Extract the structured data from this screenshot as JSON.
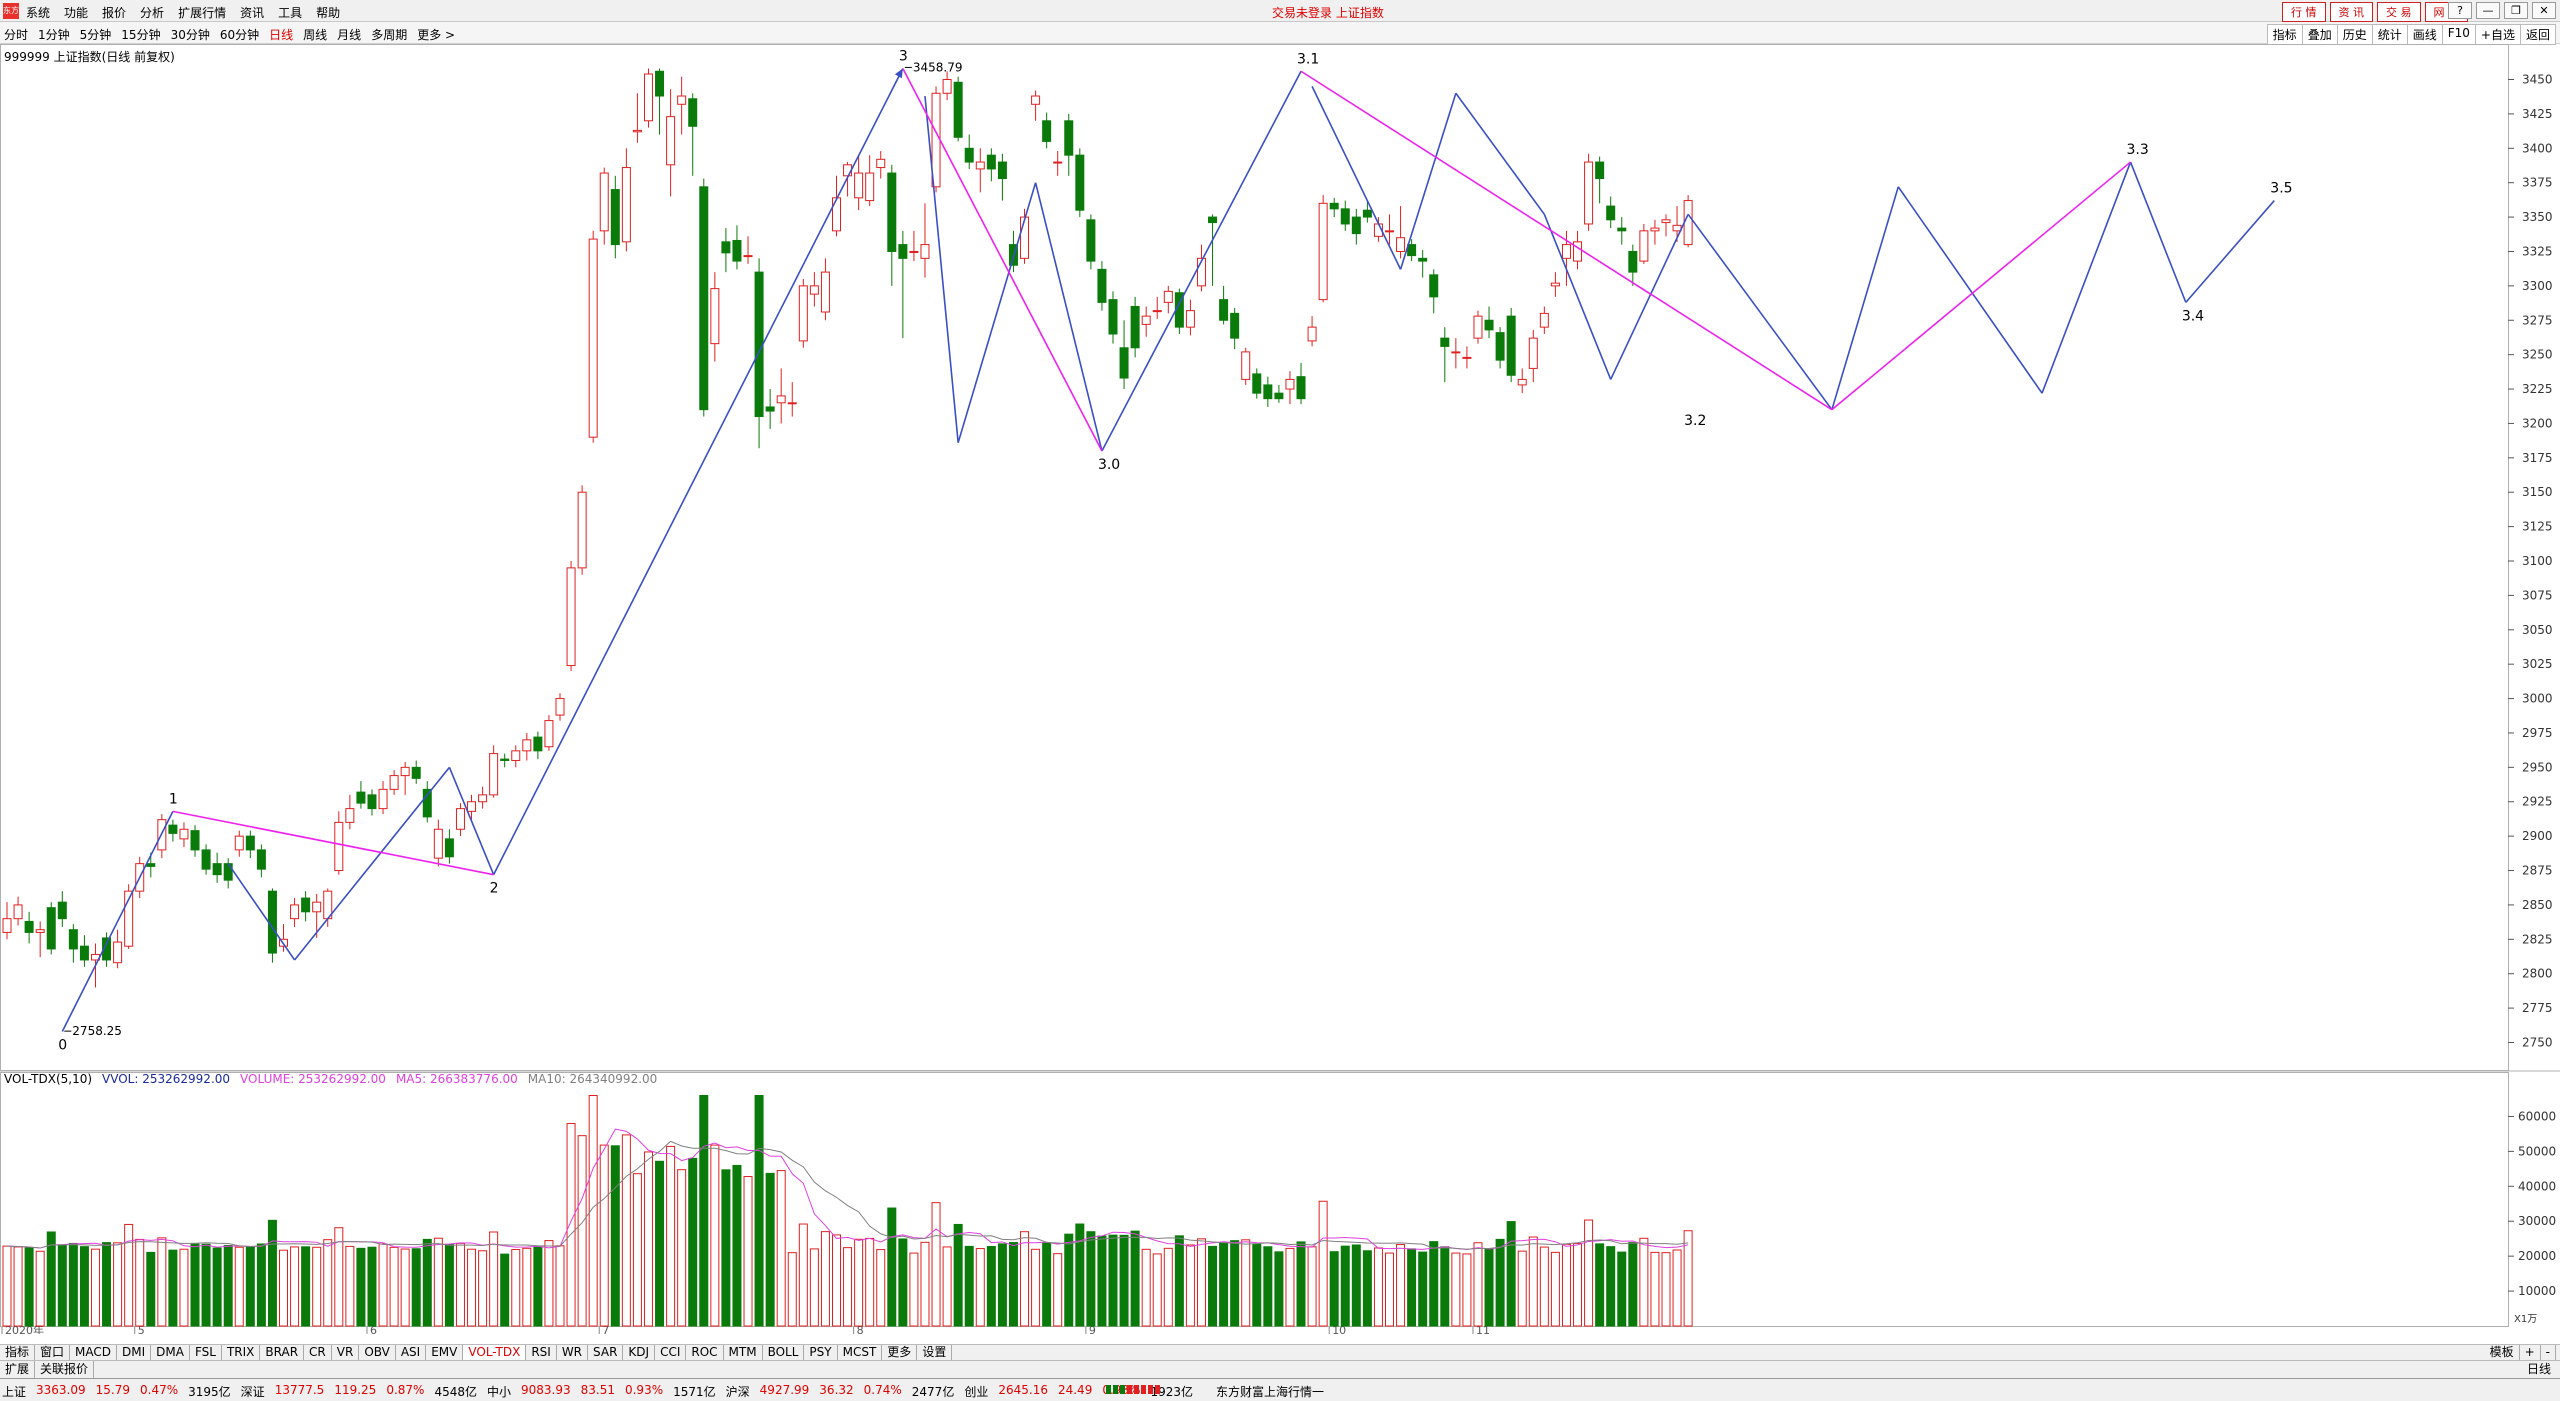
{
  "menubar": {
    "logo": "东方",
    "menus": [
      "系统",
      "功能",
      "报价",
      "分析",
      "扩展行情",
      "资讯",
      "工具",
      "帮助"
    ],
    "title": "交易未登录  上证指数",
    "right_buttons": [
      "行 情",
      "资 讯",
      "交 易",
      "网 站"
    ],
    "win_controls": [
      "?",
      "—",
      "❐",
      "✕"
    ]
  },
  "periodbar": {
    "periods": [
      "分时",
      "1分钟",
      "5分钟",
      "15分钟",
      "30分钟",
      "60分钟",
      "日线",
      "周线",
      "月线",
      "多周期",
      "更多 >"
    ],
    "active": "日线",
    "tools": [
      "指标",
      "叠加",
      "历史",
      "统计",
      "画线",
      "F10",
      "+自选",
      "返回"
    ]
  },
  "stock": {
    "label": "999999 上证指数(日线 前复权)"
  },
  "volume": {
    "title": "VOL-TDX(5,10)",
    "vvol": "VVOL: 253262992.00",
    "volume": "VOLUME: 253262992.00",
    "ma5": "MA5: 266383776.00",
    "ma10": "MA10: 264340992.00"
  },
  "colors": {
    "up": "#e02020",
    "down": "#0a7a0a",
    "wave_blue": "#3a4fc4",
    "wave_magenta": "#ee22ee",
    "ma5": "#e040e0",
    "ma10": "#808080"
  },
  "chart_data": [
    {
      "type": "candlestick",
      "ylim": [
        2730,
        3470
      ],
      "yticks": [
        2750,
        2775,
        2800,
        2825,
        2850,
        2875,
        2900,
        2925,
        2950,
        2975,
        3000,
        3025,
        3050,
        3075,
        3100,
        3125,
        3150,
        3175,
        3200,
        3225,
        3250,
        3275,
        3300,
        3325,
        3350,
        3375,
        3400,
        3425,
        3450
      ],
      "x_month_labels": [
        {
          "label": "2020年",
          "index": 0
        },
        {
          "label": "5",
          "index": 12
        },
        {
          "label": "6",
          "index": 33
        },
        {
          "label": "7",
          "index": 54
        },
        {
          "label": "8",
          "index": 77
        },
        {
          "label": "9",
          "index": 98
        },
        {
          "label": "10",
          "index": 120
        },
        {
          "label": "11",
          "index": 133
        }
      ],
      "candles": [
        [
          2830,
          2840,
          2852,
          2825
        ],
        [
          2840,
          2850,
          2856,
          2835
        ],
        [
          2838,
          2830,
          2845,
          2822
        ],
        [
          2830,
          2832,
          2838,
          2812
        ],
        [
          2848,
          2818,
          2852,
          2814
        ],
        [
          2852,
          2840,
          2860,
          2834
        ],
        [
          2832,
          2818,
          2836,
          2808
        ],
        [
          2820,
          2810,
          2828,
          2805
        ],
        [
          2810,
          2814,
          2822,
          2790
        ],
        [
          2826,
          2810,
          2830,
          2805
        ],
        [
          2808,
          2823,
          2832,
          2804
        ],
        [
          2820,
          2860,
          2865,
          2818
        ],
        [
          2860,
          2880,
          2885,
          2855
        ],
        [
          2880,
          2878,
          2888,
          2870
        ],
        [
          2890,
          2912,
          2916,
          2884
        ],
        [
          2908,
          2902,
          2912,
          2896
        ],
        [
          2898,
          2905,
          2910,
          2892
        ],
        [
          2904,
          2890,
          2908,
          2885
        ],
        [
          2890,
          2876,
          2894,
          2872
        ],
        [
          2880,
          2872,
          2888,
          2866
        ],
        [
          2880,
          2868,
          2884,
          2862
        ],
        [
          2890,
          2900,
          2904,
          2885
        ],
        [
          2900,
          2890,
          2904,
          2884
        ],
        [
          2890,
          2876,
          2894,
          2870
        ],
        [
          2860,
          2815,
          2862,
          2808
        ],
        [
          2820,
          2825,
          2836,
          2816
        ],
        [
          2840,
          2850,
          2855,
          2834
        ],
        [
          2855,
          2845,
          2860,
          2838
        ],
        [
          2845,
          2852,
          2858,
          2826
        ],
        [
          2840,
          2860,
          2862,
          2834
        ],
        [
          2875,
          2910,
          2918,
          2872
        ],
        [
          2910,
          2920,
          2930,
          2905
        ],
        [
          2932,
          2924,
          2940,
          2920
        ],
        [
          2930,
          2920,
          2934,
          2915
        ],
        [
          2920,
          2934,
          2940,
          2916
        ],
        [
          2934,
          2944,
          2948,
          2930
        ],
        [
          2944,
          2950,
          2954,
          2930
        ],
        [
          2950,
          2942,
          2955,
          2938
        ],
        [
          2934,
          2914,
          2940,
          2910
        ],
        [
          2884,
          2905,
          2912,
          2878
        ],
        [
          2898,
          2885,
          2905,
          2880
        ],
        [
          2905,
          2920,
          2924,
          2900
        ],
        [
          2918,
          2925,
          2930,
          2912
        ],
        [
          2925,
          2930,
          2936,
          2920
        ],
        [
          2930,
          2960,
          2966,
          2928
        ],
        [
          2956,
          2955,
          2960,
          2950
        ],
        [
          2955,
          2962,
          2966,
          2950
        ],
        [
          2962,
          2970,
          2975,
          2955
        ],
        [
          2972,
          2962,
          2976,
          2956
        ],
        [
          2965,
          2984,
          2988,
          2962
        ],
        [
          2988,
          3000,
          3004,
          2984
        ],
        [
          3024,
          3095,
          3100,
          3020
        ],
        [
          3095,
          3150,
          3155,
          3090
        ],
        [
          3190,
          3334,
          3340,
          3186
        ],
        [
          3340,
          3382,
          3386,
          3330
        ],
        [
          3370,
          3330,
          3380,
          3320
        ],
        [
          3332,
          3386,
          3400,
          3325
        ],
        [
          3412,
          3413,
          3440,
          3404
        ],
        [
          3420,
          3454,
          3458,
          3415
        ],
        [
          3456,
          3438,
          3458,
          3410
        ],
        [
          3388,
          3423,
          3443,
          3365
        ],
        [
          3432,
          3438,
          3452,
          3410
        ],
        [
          3436,
          3416,
          3440,
          3380
        ],
        [
          3372,
          3210,
          3378,
          3205
        ],
        [
          3258,
          3298,
          3310,
          3245
        ],
        [
          3332,
          3324,
          3342,
          3310
        ],
        [
          3333,
          3318,
          3344,
          3312
        ],
        [
          3322,
          3322,
          3336,
          3316
        ],
        [
          3310,
          3205,
          3320,
          3182
        ],
        [
          3212,
          3209,
          3225,
          3196
        ],
        [
          3215,
          3220,
          3240,
          3200
        ],
        [
          3215,
          3215,
          3230,
          3205
        ],
        [
          3260,
          3300,
          3305,
          3255
        ],
        [
          3294,
          3300,
          3310,
          3285
        ],
        [
          3281,
          3310,
          3320,
          3275
        ],
        [
          3340,
          3364,
          3380,
          3336
        ],
        [
          3380,
          3388,
          3390,
          3365
        ],
        [
          3364,
          3382,
          3395,
          3355
        ],
        [
          3362,
          3382,
          3395,
          3358
        ],
        [
          3386,
          3392,
          3398,
          3378
        ],
        [
          3382,
          3325,
          3388,
          3300
        ],
        [
          3330,
          3320,
          3340,
          3262
        ],
        [
          3325,
          3325,
          3340,
          3318
        ],
        [
          3320,
          3330,
          3360,
          3306
        ],
        [
          3372,
          3440,
          3445,
          3368
        ],
        [
          3440,
          3450,
          3456,
          3435
        ],
        [
          3448,
          3408,
          3452,
          3405
        ],
        [
          3400,
          3390,
          3410,
          3385
        ],
        [
          3385,
          3390,
          3400,
          3368
        ],
        [
          3395,
          3385,
          3400,
          3376
        ],
        [
          3390,
          3378,
          3396,
          3362
        ],
        [
          3330,
          3315,
          3340,
          3310
        ],
        [
          3320,
          3350,
          3356,
          3316
        ],
        [
          3432,
          3438,
          3442,
          3420
        ],
        [
          3420,
          3405,
          3426,
          3400
        ],
        [
          3390,
          3390,
          3398,
          3380
        ],
        [
          3420,
          3395,
          3425,
          3380
        ],
        [
          3395,
          3355,
          3400,
          3350
        ],
        [
          3348,
          3318,
          3352,
          3312
        ],
        [
          3312,
          3288,
          3318,
          3282
        ],
        [
          3290,
          3265,
          3296,
          3258
        ],
        [
          3255,
          3233,
          3275,
          3225
        ],
        [
          3285,
          3255,
          3292,
          3248
        ],
        [
          3272,
          3278,
          3285,
          3263
        ],
        [
          3282,
          3282,
          3292,
          3276
        ],
        [
          3288,
          3296,
          3300,
          3280
        ],
        [
          3295,
          3270,
          3298,
          3265
        ],
        [
          3270,
          3282,
          3290,
          3264
        ],
        [
          3300,
          3320,
          3330,
          3296
        ],
        [
          3350,
          3346,
          3352,
          3300
        ],
        [
          3290,
          3275,
          3300,
          3272
        ],
        [
          3280,
          3262,
          3284,
          3254
        ],
        [
          3232,
          3252,
          3255,
          3228
        ],
        [
          3236,
          3222,
          3240,
          3218
        ],
        [
          3228,
          3218,
          3234,
          3212
        ],
        [
          3222,
          3218,
          3228,
          3215
        ],
        [
          3225,
          3232,
          3238,
          3214
        ],
        [
          3234,
          3218,
          3244,
          3214
        ],
        [
          3260,
          3270,
          3278,
          3256
        ],
        [
          3290,
          3360,
          3366,
          3288
        ],
        [
          3360,
          3356,
          3364,
          3350
        ],
        [
          3356,
          3345,
          3362,
          3340
        ],
        [
          3350,
          3338,
          3356,
          3330
        ],
        [
          3355,
          3350,
          3362,
          3346
        ],
        [
          3336,
          3345,
          3350,
          3332
        ],
        [
          3340,
          3340,
          3352,
          3330
        ],
        [
          3325,
          3335,
          3358,
          3320
        ],
        [
          3330,
          3322,
          3334,
          3318
        ],
        [
          3320,
          3318,
          3326,
          3306
        ],
        [
          3308,
          3292,
          3312,
          3280
        ],
        [
          3262,
          3256,
          3270,
          3230
        ],
        [
          3252,
          3252,
          3262,
          3240
        ],
        [
          3248,
          3248,
          3256,
          3240
        ],
        [
          3262,
          3278,
          3282,
          3258
        ],
        [
          3275,
          3268,
          3285,
          3262
        ],
        [
          3266,
          3246,
          3270,
          3240
        ],
        [
          3278,
          3235,
          3284,
          3230
        ],
        [
          3228,
          3232,
          3240,
          3222
        ],
        [
          3240,
          3262,
          3268,
          3230
        ],
        [
          3270,
          3280,
          3285,
          3265
        ],
        [
          3300,
          3302,
          3310,
          3292
        ],
        [
          3320,
          3330,
          3340,
          3300
        ],
        [
          3318,
          3332,
          3340,
          3312
        ],
        [
          3345,
          3390,
          3396,
          3340
        ],
        [
          3390,
          3378,
          3394,
          3360
        ],
        [
          3358,
          3348,
          3365,
          3342
        ],
        [
          3342,
          3340,
          3350,
          3330
        ],
        [
          3325,
          3310,
          3330,
          3300
        ],
        [
          3318,
          3340,
          3345,
          3316
        ],
        [
          3340,
          3342,
          3348,
          3330
        ],
        [
          3346,
          3348,
          3352,
          3336
        ],
        [
          3340,
          3344,
          3358,
          3332
        ],
        [
          3330,
          3362,
          3366,
          3328
        ]
      ],
      "wave_labels": [
        {
          "label": "0",
          "index": 5,
          "price": 2758
        },
        {
          "label": "1",
          "index": 15,
          "price": 2918
        },
        {
          "label": "2",
          "index": 44,
          "price": 2872
        },
        {
          "label": "3",
          "index": 81,
          "price": 3458
        },
        {
          "label": "3.0",
          "index": 99,
          "price": 3180
        },
        {
          "label": "3.1",
          "index": 117,
          "price": 3456
        },
        {
          "label": "3.2",
          "index": 152,
          "price": 3212
        },
        {
          "label": "3.3",
          "index": 192,
          "price": 3390
        },
        {
          "label": "3.4",
          "index": 197,
          "price": 3288
        },
        {
          "label": "3.5",
          "index": 205,
          "price": 3362
        }
      ],
      "price_annotations": [
        {
          "label": "2758.25",
          "index": 5,
          "price": 2758.25
        },
        {
          "label": "3458.79",
          "index": 81,
          "price": 3458.79
        }
      ]
    },
    {
      "type": "bar",
      "ylim": [
        0,
        70000
      ],
      "yticks": [
        10000,
        20000,
        30000,
        40000,
        50000,
        60000
      ],
      "ylabel": "X1万"
    }
  ],
  "bottom_tabs": [
    "指标",
    "窗口",
    "MACD",
    "DMI",
    "DMA",
    "FSL",
    "TRIX",
    "BRAR",
    "CR",
    "VR",
    "OBV",
    "ASI",
    "EMV",
    "VOL-TDX",
    "RSI",
    "WR",
    "SAR",
    "KDJ",
    "CCI",
    "ROC",
    "MTM",
    "BOLL",
    "PSY",
    "MCST",
    "更多",
    "设置"
  ],
  "bottom_tab_active": "VOL-TDX",
  "bottom_right": [
    "模板",
    "+",
    "-"
  ],
  "sub_tabs": [
    "扩展",
    "关联报价"
  ],
  "period_corner": "日线",
  "status": {
    "sh": "上证",
    "sh_val": "3363.09",
    "sh_chg": "15.79",
    "sh_pct": "0.47%",
    "sh_amt": "3195亿",
    "sz": "深证",
    "sz_val": "13777.5",
    "sz_chg": "119.25",
    "sz_pct": "0.87%",
    "sz_amt": "4548亿",
    "zx": "中小",
    "zx_val": "9083.93",
    "zx_chg": "83.51",
    "zx_pct": "0.93%",
    "zx_amt": "1571亿",
    "hs": "沪深",
    "hs_val": "4927.99",
    "hs_chg": "36.32",
    "hs_pct": "0.74%",
    "hs_amt": "2477亿",
    "cy": "创业",
    "cy_val": "2645.16",
    "cy_chg": "24.49",
    "cy_pct": "0.93%",
    "cy_amt": "1923亿",
    "ticker": "东方财富上海行情一"
  }
}
